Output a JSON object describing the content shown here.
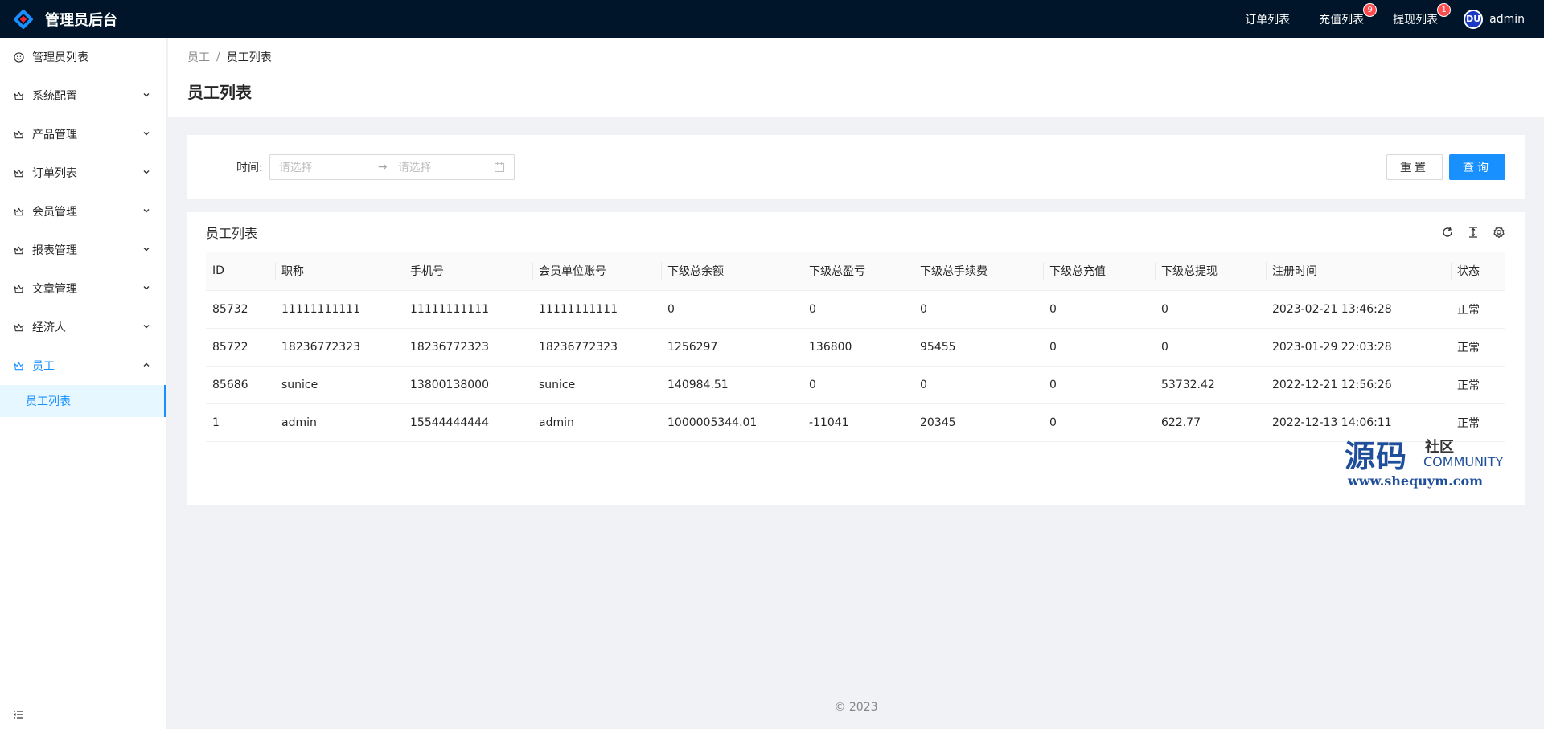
{
  "app": {
    "title": "管理员后台"
  },
  "header": {
    "nav": [
      {
        "label": "订单列表",
        "badge": ""
      },
      {
        "label": "充值列表",
        "badge": "9"
      },
      {
        "label": "提现列表",
        "badge": "1"
      }
    ],
    "user": {
      "name": "admin",
      "avatar_text": "DU"
    }
  },
  "sidebar": {
    "items": [
      {
        "label": "管理员列表",
        "icon": "smile-icon",
        "has_children": false
      },
      {
        "label": "系统配置",
        "icon": "crown-icon",
        "has_children": true
      },
      {
        "label": "产品管理",
        "icon": "crown-icon",
        "has_children": true
      },
      {
        "label": "订单列表",
        "icon": "crown-icon",
        "has_children": true
      },
      {
        "label": "会员管理",
        "icon": "crown-icon",
        "has_children": true
      },
      {
        "label": "报表管理",
        "icon": "crown-icon",
        "has_children": true
      },
      {
        "label": "文章管理",
        "icon": "crown-icon",
        "has_children": true
      },
      {
        "label": "经济人",
        "icon": "crown-icon",
        "has_children": true
      },
      {
        "label": "员工",
        "icon": "crown-icon",
        "has_children": true,
        "open": true
      }
    ],
    "active_sub": "员工列表"
  },
  "breadcrumb": {
    "parent": "员工",
    "separator": "/",
    "current": "员工列表"
  },
  "page": {
    "title": "员工列表"
  },
  "search": {
    "time_label": "时间:",
    "start_placeholder": "请选择",
    "end_placeholder": "请选择",
    "range_separator": "→",
    "reset_label": "重置",
    "submit_label": "查询"
  },
  "table": {
    "title": "员工列表",
    "columns": [
      "ID",
      "职称",
      "手机号",
      "会员单位账号",
      "下级总余额",
      "下级总盈亏",
      "下级总手续费",
      "下级总充值",
      "下级总提现",
      "注册时间",
      "状态"
    ],
    "rows": [
      [
        "85732",
        "11111111111",
        "11111111111",
        "11111111111",
        "0",
        "0",
        "0",
        "0",
        "0",
        "2023-02-21 13:46:28",
        "正常"
      ],
      [
        "85722",
        "18236772323",
        "18236772323",
        "18236772323",
        "1256297",
        "136800",
        "95455",
        "0",
        "0",
        "2023-01-29 22:03:28",
        "正常"
      ],
      [
        "85686",
        "sunice",
        "13800138000",
        "sunice",
        "140984.51",
        "0",
        "0",
        "0",
        "53732.42",
        "2022-12-21 12:56:26",
        "正常"
      ],
      [
        "1",
        "admin",
        "15544444444",
        "admin",
        "1000005344.01",
        "-11041",
        "20345",
        "0",
        "622.77",
        "2022-12-13 14:06:11",
        "正常"
      ]
    ]
  },
  "watermark": {
    "big": "源码",
    "small": "社区",
    "community": "COMMUNITY",
    "url": "www.shequym.com"
  },
  "footer": {
    "text": "© 2023"
  },
  "colors": {
    "primary": "#1890ff",
    "header_bg": "#001529",
    "badge": "#ff4d4f"
  }
}
